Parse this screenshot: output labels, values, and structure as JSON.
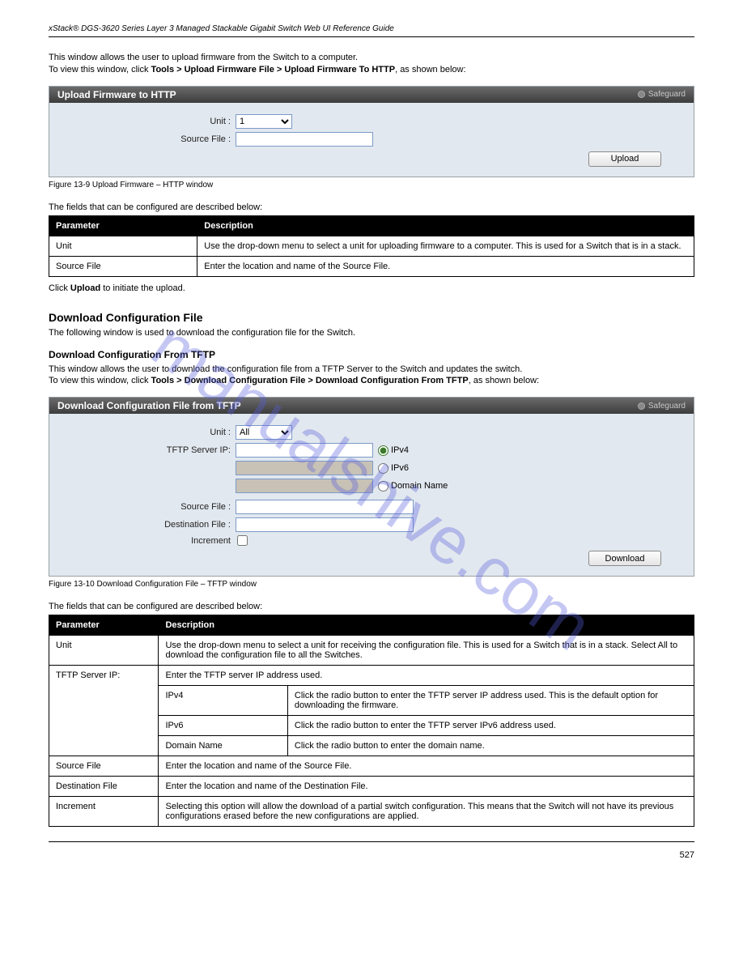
{
  "header": {
    "left": "xStack® DGS-3620 Series Layer 3 Managed Stackable Gigabit Switch Web UI Reference Guide",
    "right": ""
  },
  "watermark": "manualshive.com",
  "section1": {
    "intro_prefix": "This window allows the user to upload firmware from the Switch to a computer.",
    "intro_view": "To view this window, click ",
    "intro_bold": "Tools > Upload Firmware File > Upload Firmware To HTTP",
    "intro_suffix": ", as shown below:",
    "panel_title": "Upload Firmware to HTTP",
    "safeguard": "Safeguard",
    "labels": {
      "unit": "Unit :",
      "source": "Source File :"
    },
    "unit_value": "1",
    "btn": "Upload",
    "caption": "Figure 13-9 Upload Firmware – HTTP window",
    "fields_label": "The fields that can be configured are described below:",
    "table": {
      "head": [
        "Parameter",
        "Description"
      ],
      "rows": [
        [
          "Unit",
          "Use the drop-down menu to select a unit for uploading firmware to a computer. This is used for a Switch that is in a stack."
        ],
        [
          "Source File",
          "Enter the location and name of the Source File."
        ]
      ]
    },
    "after_prefix": "Click ",
    "after_bold": "Upload",
    "after_suffix": " to initiate the upload."
  },
  "section2": {
    "title": "Download Configuration File",
    "intro": "The following window is used to download the configuration file for the Switch.",
    "sub_title": "Download Configuration From TFTP",
    "sub_intro_prefix": "This window allows the user to download the configuration file from a TFTP Server to the Switch and updates the switch.",
    "intro_view": "To view this window, click ",
    "intro_bold": "Tools > Download Configuration File > Download Configuration From TFTP",
    "intro_suffix": ", as shown below:",
    "panel_title": "Download Configuration File from TFTP",
    "safeguard": "Safeguard",
    "labels": {
      "unit": "Unit :",
      "tftp": "TFTP Server IP:",
      "ipv4": "IPv4",
      "ipv6": "IPv6",
      "domain": "Domain Name",
      "source": "Source File :",
      "dest": "Destination File :",
      "increment": "Increment"
    },
    "unit_value": "All",
    "btn": "Download",
    "caption": "Figure 13-10 Download Configuration File – TFTP window",
    "fields_label": "The fields that can be configured are described below:",
    "table": {
      "head": [
        "Parameter",
        "Description"
      ],
      "rows_top": [
        [
          "Unit",
          "Use the drop-down menu to select a unit for receiving the configuration file. This is used for a Switch that is in a stack. Select All to download the configuration file to all the Switches."
        ]
      ],
      "tftp_intro": "Enter the TFTP server IP address used.",
      "tftp_sub": [
        [
          "IPv4",
          "Click the radio button to enter the TFTP server IP address used. This is the default option for downloading the firmware."
        ],
        [
          "IPv6",
          "Click the radio button to enter the TFTP server IPv6 address used."
        ],
        [
          "Domain Name",
          "Click the radio button to enter the domain name."
        ]
      ],
      "rows_bottom": [
        [
          "Source File",
          "Enter the location and name of the Source File."
        ],
        [
          "Destination File",
          "Enter the location and name of the Destination File."
        ],
        [
          "Increment",
          "Selecting this option will allow the download of a partial switch configuration. This means that the Switch will not have its previous configurations erased before the new configurations are applied."
        ]
      ]
    }
  },
  "footer": {
    "page": "527"
  }
}
